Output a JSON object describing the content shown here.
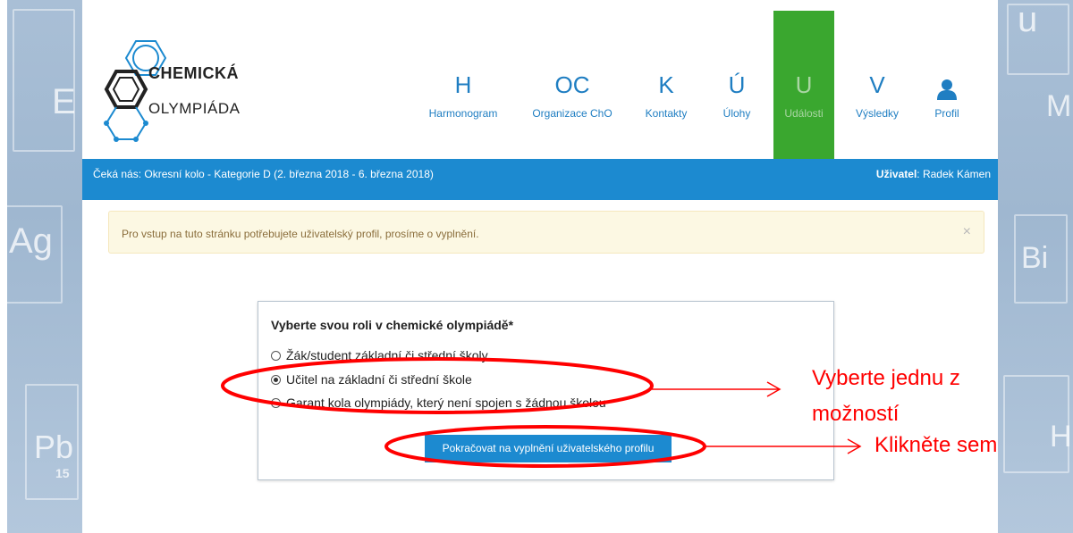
{
  "logo": {
    "line1": "CHEMICKÁ",
    "line2": "OLYMPIÁDA"
  },
  "nav": [
    {
      "letter": "H",
      "label": "Harmonogram",
      "icon": ""
    },
    {
      "letter": "OC",
      "label": "Organizace ChO",
      "icon": ""
    },
    {
      "letter": "K",
      "label": "Kontakty",
      "icon": ""
    },
    {
      "letter": "Ú",
      "label": "Úlohy",
      "icon": ""
    },
    {
      "letter": "U",
      "label": "Události",
      "icon": ""
    },
    {
      "letter": "V",
      "label": "Výsledky",
      "icon": ""
    },
    {
      "letter": "",
      "label": "Profil",
      "icon": "user-icon"
    }
  ],
  "colors": {
    "brand_blue": "#1c8ad0",
    "active_green": "#3aa72f",
    "annotation_red": "#ff0000",
    "alert_bg": "#fcf8e3"
  },
  "infobar": {
    "upcoming": "Čeká nás: Okresní kolo - Kategorie D (2. března 2018 - 6. března 2018)",
    "user_label": "Uživatel",
    "user_name": ": Radek Kámen"
  },
  "alert": {
    "message": "Pro vstup na tuto stránku potřebujete uživatelský profil, prosíme o vyplnění.",
    "close": "×"
  },
  "role_form": {
    "question": "Vyberte svou roli v chemické olympiádě*",
    "options": [
      {
        "label": "Žák/student základní či střední školy",
        "checked": false
      },
      {
        "label": "Učitel na základní či střední škole",
        "checked": true
      },
      {
        "label": "Garant kola olympiády, který není spojen s žádnou školou",
        "checked": false
      }
    ],
    "continue_button": "Pokračovat na vyplnění uživatelského profilu"
  },
  "annotations": {
    "choose_line1": "Vyberte jednu z",
    "choose_line2": "možností",
    "click_here": "Klikněte sem"
  },
  "background_elements": [
    "Ag",
    "Pb",
    "15",
    "u",
    "Bi",
    "E",
    "M",
    "H"
  ]
}
